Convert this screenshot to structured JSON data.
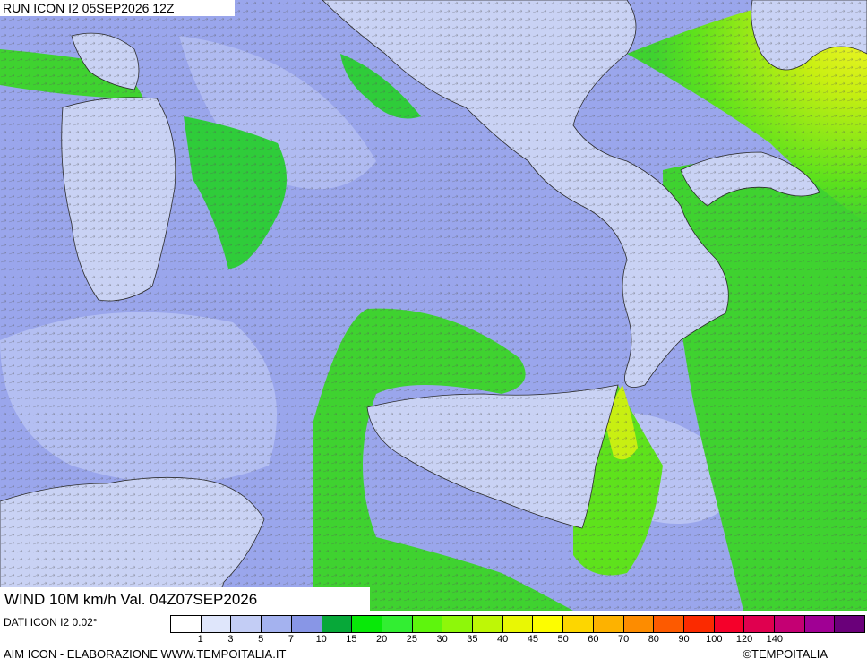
{
  "header": {
    "run_label": "RUN ICON I2 05SEP2026 12Z"
  },
  "footer": {
    "title": "WIND 10M km/h Val. 04Z07SEP2026",
    "dati": "DATI ICON I2 0.02°",
    "credit": "AIM ICON - ELABORAZIONE WWW.TEMPOITALIA.IT",
    "brand": "TEMPOITALIA",
    "copyright_symbol": "©"
  },
  "legend": {
    "colors": [
      "#ffffff",
      "#dfe6fb",
      "#c3cdf5",
      "#a4b2ef",
      "#8896e6",
      "#07a839",
      "#08e908",
      "#32ee32",
      "#5ef50d",
      "#8ef70a",
      "#bef706",
      "#e9f704",
      "#fdfd00",
      "#fdd600",
      "#fdb200",
      "#fd8c00",
      "#fd5a00",
      "#fb2a00",
      "#f5002a",
      "#e0004f",
      "#c40073",
      "#a00094",
      "#6a007a"
    ],
    "labels": [
      "1",
      "3",
      "5",
      "7",
      "10",
      "15",
      "20",
      "25",
      "30",
      "35",
      "40",
      "45",
      "50",
      "60",
      "70",
      "80",
      "90",
      "100",
      "120",
      "140"
    ]
  },
  "map_colors": {
    "sea_calm": "#9aa6ec",
    "sea_lighter": "#b8c2f2",
    "land": "#c9d2f4",
    "strong_green": "#2fd13a",
    "mid_green": "#5ee21c",
    "yellow_green": "#c8ef12",
    "yellow": "#f6f52a",
    "coast": "#2a2a2a"
  }
}
